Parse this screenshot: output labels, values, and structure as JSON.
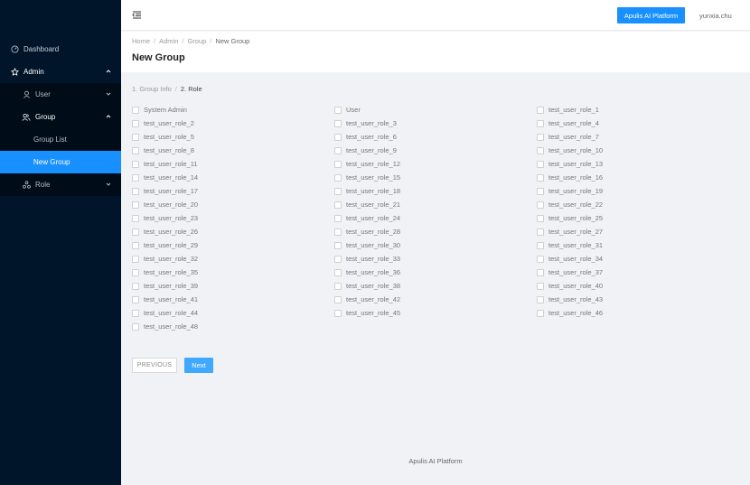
{
  "sidebar": {
    "items": [
      {
        "label": "Dashboard",
        "icon": "dashboard-icon"
      },
      {
        "label": "Admin",
        "icon": "admin-icon"
      },
      {
        "label": "User",
        "icon": "user-icon"
      },
      {
        "label": "Group",
        "icon": "group-icon"
      },
      {
        "label": "Group List"
      },
      {
        "label": "New Group"
      },
      {
        "label": "Role",
        "icon": "role-icon"
      }
    ]
  },
  "header": {
    "platform_button": "Apulis AI Platform",
    "username": "yunxia.chu"
  },
  "breadcrumb": [
    "Home",
    "Admin",
    "Group",
    "New Group"
  ],
  "page_title": "New Group",
  "steps": [
    "1. Group Info",
    "2. Role"
  ],
  "roles": [
    "System Admin",
    "User",
    "test_user_role_1",
    "test_user_role_2",
    "test_user_role_3",
    "test_user_role_4",
    "test_user_role_5",
    "test_user_role_6",
    "test_user_role_7",
    "test_user_role_8",
    "test_user_role_9",
    "test_user_role_10",
    "test_user_role_11",
    "test_user_role_12",
    "test_user_role_13",
    "test_user_role_14",
    "test_user_role_15",
    "test_user_role_16",
    "test_user_role_17",
    "test_user_role_18",
    "test_user_role_19",
    "test_user_role_20",
    "test_user_role_21",
    "test_user_role_22",
    "test_user_role_23",
    "test_user_role_24",
    "test_user_role_25",
    "test_user_role_26",
    "test_user_role_28",
    "test_user_role_27",
    "test_user_role_29",
    "test_user_role_30",
    "test_user_role_31",
    "test_user_role_32",
    "test_user_role_33",
    "test_user_role_34",
    "test_user_role_35",
    "test_user_role_36",
    "test_user_role_37",
    "test_user_role_39",
    "test_user_role_38",
    "test_user_role_40",
    "test_user_role_41",
    "test_user_role_42",
    "test_user_role_43",
    "test_user_role_44",
    "test_user_role_45",
    "test_user_role_46",
    "test_user_role_48"
  ],
  "buttons": {
    "previous": "PREVIOUS",
    "next": "Next"
  },
  "footer": "Apulis AI Platform",
  "colors": {
    "sidebar_bg": "#001529",
    "accent": "#1890ff"
  }
}
